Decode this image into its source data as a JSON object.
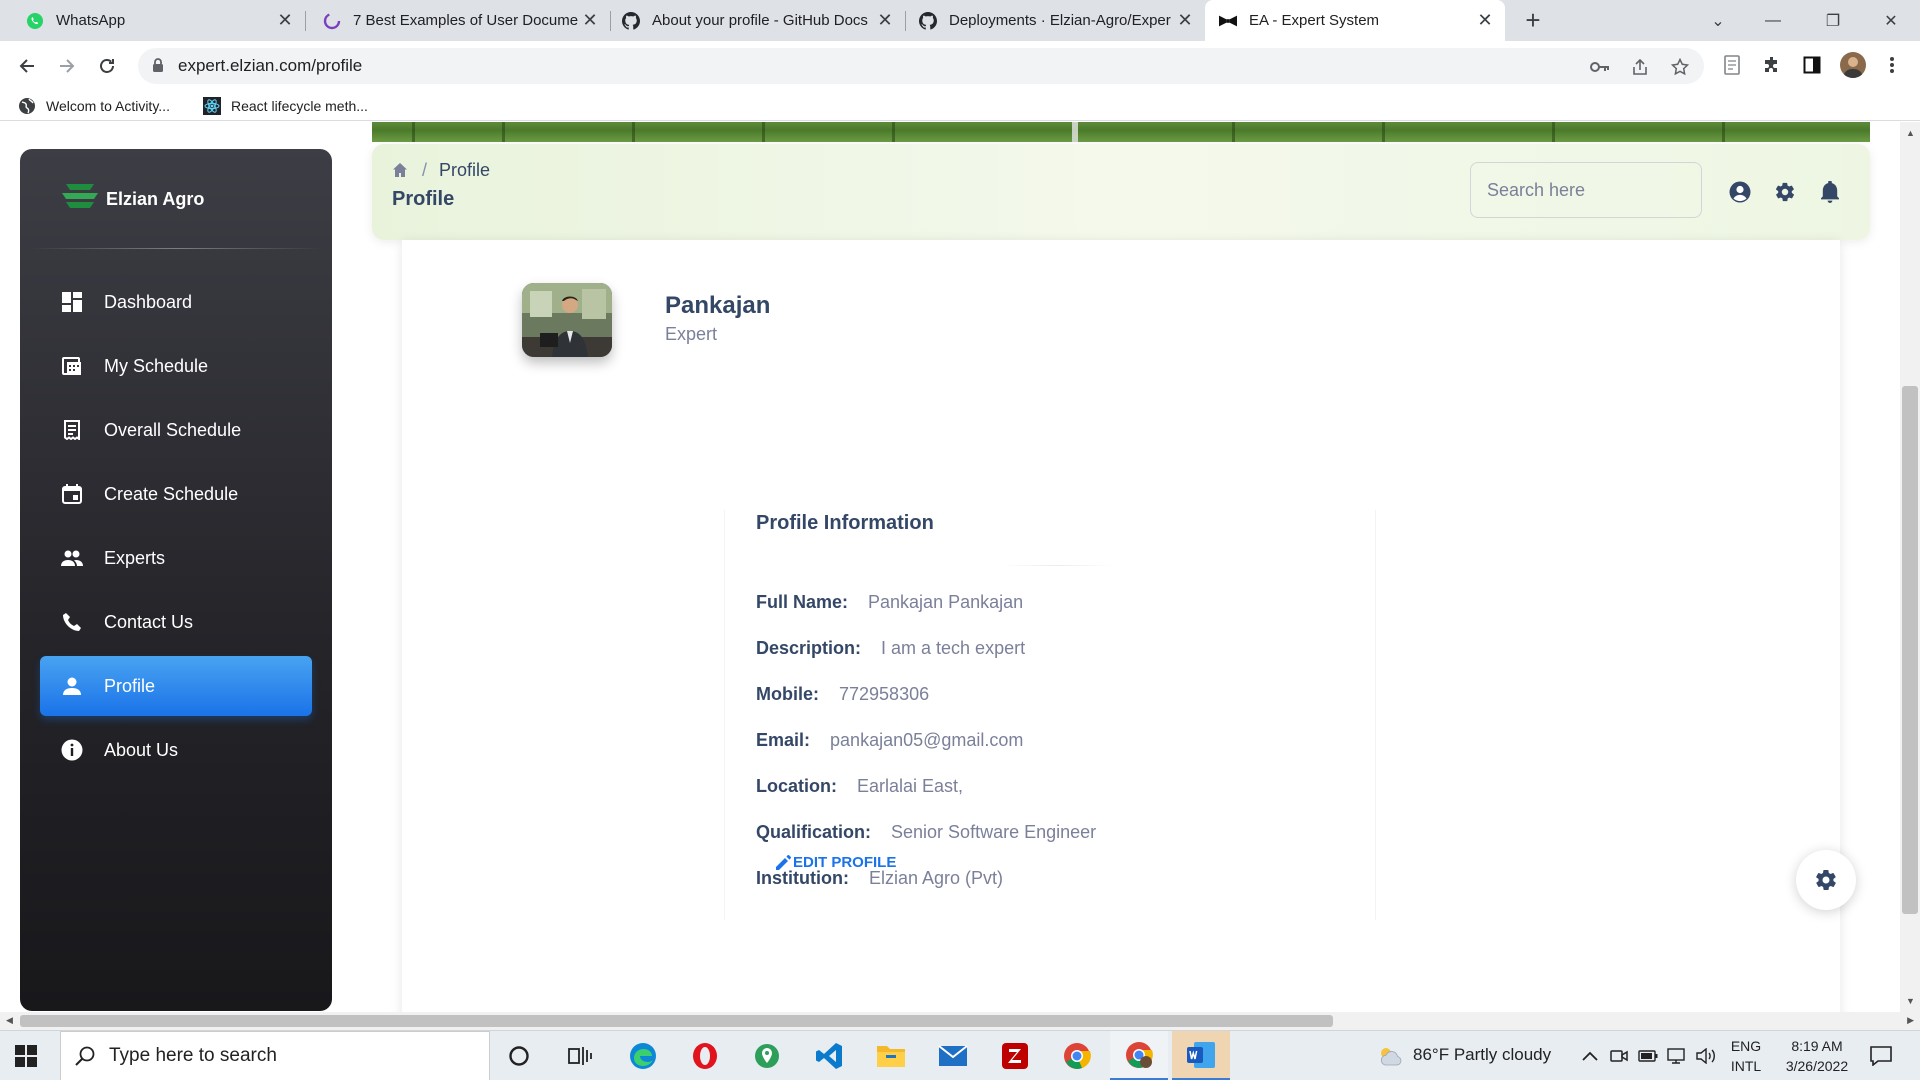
{
  "browser": {
    "tabs": [
      {
        "title": "WhatsApp",
        "icon": "whatsapp-icon"
      },
      {
        "title": "7 Best Examples of User Docume",
        "icon": "loading-icon"
      },
      {
        "title": "About your profile - GitHub Docs",
        "icon": "github-icon"
      },
      {
        "title": "Deployments · Elzian-Agro/Exper",
        "icon": "github-icon"
      },
      {
        "title": "EA - Expert System",
        "icon": "bowtie-icon",
        "active": true
      }
    ],
    "url": "expert.elzian.com/profile",
    "bookmarks": [
      {
        "label": "Welcom to Activity...",
        "icon": "globe-icon"
      },
      {
        "label": "React lifecycle meth...",
        "icon": "react-icon"
      }
    ]
  },
  "sidebar": {
    "brand": "Elzian Agro",
    "items": [
      {
        "label": "Dashboard",
        "icon": "dashboard-icon"
      },
      {
        "label": "My Schedule",
        "icon": "schedule-icon"
      },
      {
        "label": "Overall Schedule",
        "icon": "receipt-icon"
      },
      {
        "label": "Create Schedule",
        "icon": "calendar-icon"
      },
      {
        "label": "Experts",
        "icon": "people-icon"
      },
      {
        "label": "Contact Us",
        "icon": "phone-icon"
      },
      {
        "label": "Profile",
        "icon": "person-icon",
        "active": true
      },
      {
        "label": "About Us",
        "icon": "info-icon"
      }
    ],
    "active_color": "#1A73E8"
  },
  "header": {
    "breadcrumb": "Profile",
    "title": "Profile",
    "search_placeholder": "Search here"
  },
  "profile": {
    "name": "Pankajan",
    "role": "Expert",
    "info_title": "Profile Information",
    "fields": [
      {
        "label": "Full Name:",
        "value": "Pankajan Pankajan"
      },
      {
        "label": "Description:",
        "value": "I am a tech expert"
      },
      {
        "label": "Mobile:",
        "value": "772958306"
      },
      {
        "label": "Email:",
        "value": "pankajan05@gmail.com"
      },
      {
        "label": "Location:",
        "value": "Earlalai East,"
      },
      {
        "label": "Qualification:",
        "value": "Senior Software Engineer"
      },
      {
        "label": "Institution:",
        "value": "Elzian Agro (Pvt)"
      }
    ],
    "edit_label": "EDIT PROFILE"
  },
  "taskbar": {
    "search_placeholder": "Type here to search",
    "weather": "86°F  Partly cloudy",
    "lang_line1": "ENG",
    "lang_line2": "INTL",
    "time": "8:19 AM",
    "date": "3/26/2022"
  }
}
